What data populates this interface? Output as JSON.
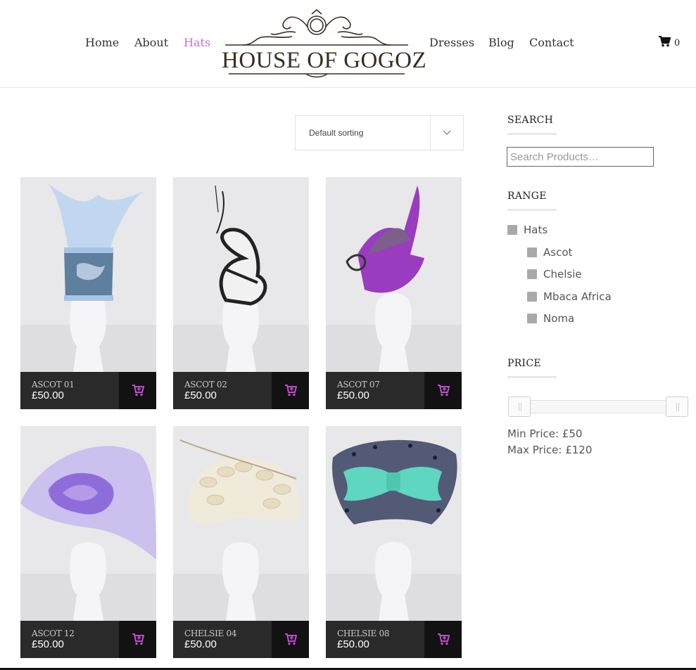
{
  "header": {
    "nav_left": [
      {
        "label": "Home"
      },
      {
        "label": "About"
      },
      {
        "label": "Hats"
      }
    ],
    "nav_right": [
      {
        "label": "Dresses"
      },
      {
        "label": "Blog"
      },
      {
        "label": "Contact"
      }
    ],
    "logo_text": "HOUSE OF GOGOZ",
    "active_nav": "Hats",
    "accent_color": "#c86fd3",
    "cart_count": "0"
  },
  "sorting": {
    "selected": "Default sorting"
  },
  "products": [
    {
      "name": "ASCOT 01",
      "price": "£50.00"
    },
    {
      "name": "ASCOT 02",
      "price": "£50.00"
    },
    {
      "name": "ASCOT 07",
      "price": "£50.00"
    },
    {
      "name": "ASCOT 12",
      "price": "£50.00"
    },
    {
      "name": "CHELSIE 04",
      "price": "£50.00"
    },
    {
      "name": "CHELSIE 08",
      "price": "£50.00"
    }
  ],
  "sidebar": {
    "search": {
      "title": "SEARCH",
      "placeholder": "Search Products…"
    },
    "range": {
      "title": "RANGE",
      "items": [
        {
          "label": "Hats"
        },
        {
          "label": "Ascot"
        },
        {
          "label": "Chelsie"
        },
        {
          "label": "Mbaca Africa"
        },
        {
          "label": "Noma"
        }
      ]
    },
    "price": {
      "title": "PRICE",
      "min_label": "Min Price: £50",
      "max_label": "Max Price: £120",
      "min_value": 50,
      "max_value": 120
    }
  },
  "icons": {
    "cart": "cart-icon",
    "add_to_cart": "cart-plus-icon",
    "sort_toggle": "chevron-down-icon"
  }
}
